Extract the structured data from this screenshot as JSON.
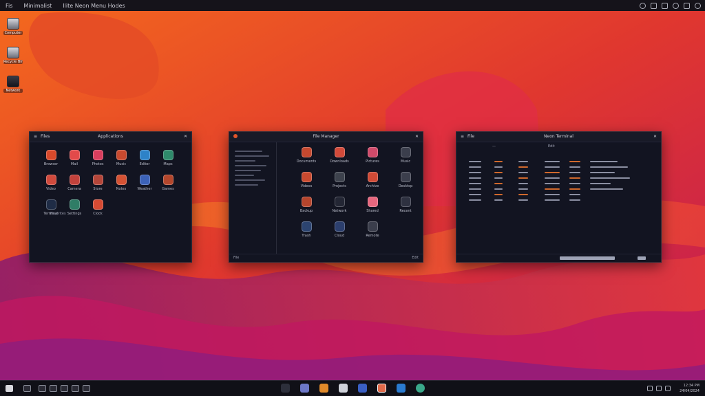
{
  "topbar": {
    "menu": [
      "Fis",
      "Minimalist",
      "Ilite Neon Menu Hodes"
    ],
    "tray_icons": [
      "user-icon",
      "gear-icon",
      "phone-icon",
      "notification-icon",
      "battery-icon",
      "wifi-icon"
    ]
  },
  "desktop_icons": [
    {
      "label": "Computer",
      "icon": "computer-icon"
    },
    {
      "label": "Recycle Bin",
      "icon": "trash-icon"
    },
    {
      "label": "Network",
      "icon": "network-icon"
    }
  ],
  "windows": [
    {
      "title": "Applications",
      "left_label": "Files",
      "icon_color": "#e0542b",
      "apps": [
        {
          "label": "Browser",
          "color": "#d8492b"
        },
        {
          "label": "Mail",
          "color": "#e24a4a"
        },
        {
          "label": "Photos",
          "color": "#d83e5e"
        },
        {
          "label": "Music",
          "color": "#c94a2f"
        },
        {
          "label": "Editor",
          "color": "#2d82c8"
        },
        {
          "label": "Maps",
          "color": "#2f8a6b"
        },
        {
          "label": "Video",
          "color": "#d04a3d"
        },
        {
          "label": "Camera",
          "color": "#c2423c"
        },
        {
          "label": "Store",
          "color": "#b4463a"
        },
        {
          "label": "Notes",
          "color": "#d55234"
        },
        {
          "label": "Weather",
          "color": "#3c62b8"
        },
        {
          "label": "Games",
          "color": "#b4472d"
        },
        {
          "label": "Terminal",
          "color": "#1f2c46"
        },
        {
          "label": "Settings",
          "color": "#2f7d66"
        },
        {
          "label": "Clock",
          "color": "#d64b33"
        }
      ],
      "side_label": "Favorites"
    },
    {
      "title": "File Manager",
      "statusbar_left": "File",
      "statusbar_right": "Edit",
      "apps": [
        {
          "label": "Documents",
          "color": "#c4482f"
        },
        {
          "label": "Downloads",
          "color": "#d24a3a"
        },
        {
          "label": "Pictures",
          "color": "#cf4a6a"
        },
        {
          "label": "Music",
          "color": "#3b3e4c"
        },
        {
          "label": "Videos",
          "color": "#c94a2f"
        },
        {
          "label": "Projects",
          "color": "#3d424d"
        },
        {
          "label": "Archive",
          "color": "#cf4a36"
        },
        {
          "label": "Desktop",
          "color": "#3b3e4c"
        },
        {
          "label": "Backup",
          "color": "#b5452d"
        },
        {
          "label": "Network",
          "color": "#232634"
        },
        {
          "label": "Shared",
          "color": "#e6677e"
        },
        {
          "label": "Recent",
          "color": "#2e3140"
        },
        {
          "label": "Trash",
          "color": "#2c4470"
        },
        {
          "label": "Cloud",
          "color": "#2c3f6e"
        },
        {
          "label": "Remote",
          "color": "#3b3e4c"
        }
      ]
    },
    {
      "title": "Neon Terminal",
      "left_label": "File",
      "tab_label": "Edit"
    }
  ],
  "taskbar": {
    "apps": [
      "start-icon",
      "search-icon",
      "files-icon",
      "browser-icon",
      "mail-icon",
      "terminal-icon",
      "music-icon",
      "settings-icon"
    ],
    "clock": "12:34 PM",
    "date": "24/04/2024"
  }
}
